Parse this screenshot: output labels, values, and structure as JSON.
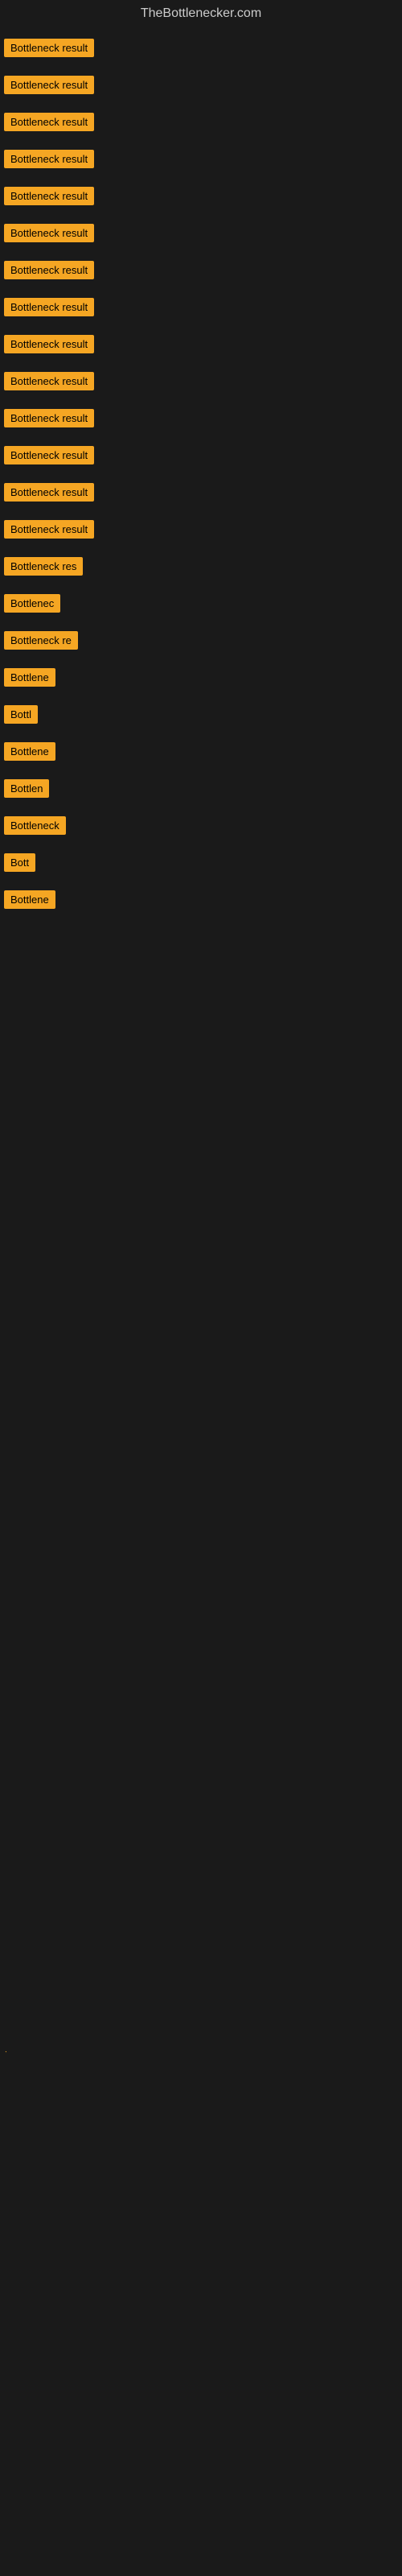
{
  "site": {
    "title": "TheBottlenecker.com"
  },
  "items": [
    {
      "id": 1,
      "label": "Bottleneck result",
      "width": 130
    },
    {
      "id": 2,
      "label": "Bottleneck result",
      "width": 130
    },
    {
      "id": 3,
      "label": "Bottleneck result",
      "width": 130
    },
    {
      "id": 4,
      "label": "Bottleneck result",
      "width": 130
    },
    {
      "id": 5,
      "label": "Bottleneck result",
      "width": 130
    },
    {
      "id": 6,
      "label": "Bottleneck result",
      "width": 130
    },
    {
      "id": 7,
      "label": "Bottleneck result",
      "width": 130
    },
    {
      "id": 8,
      "label": "Bottleneck result",
      "width": 130
    },
    {
      "id": 9,
      "label": "Bottleneck result",
      "width": 130
    },
    {
      "id": 10,
      "label": "Bottleneck result",
      "width": 130
    },
    {
      "id": 11,
      "label": "Bottleneck result",
      "width": 130
    },
    {
      "id": 12,
      "label": "Bottleneck result",
      "width": 130
    },
    {
      "id": 13,
      "label": "Bottleneck result",
      "width": 130
    },
    {
      "id": 14,
      "label": "Bottleneck result",
      "width": 130
    },
    {
      "id": 15,
      "label": "Bottleneck res",
      "width": 110
    },
    {
      "id": 16,
      "label": "Bottlenec",
      "width": 80
    },
    {
      "id": 17,
      "label": "Bottleneck re",
      "width": 100
    },
    {
      "id": 18,
      "label": "Bottlene",
      "width": 72
    },
    {
      "id": 19,
      "label": "Bottl",
      "width": 52
    },
    {
      "id": 20,
      "label": "Bottlene",
      "width": 72
    },
    {
      "id": 21,
      "label": "Bottlen",
      "width": 65
    },
    {
      "id": 22,
      "label": "Bottleneck",
      "width": 85
    },
    {
      "id": 23,
      "label": "Bott",
      "width": 44
    },
    {
      "id": 24,
      "label": "Bottlene",
      "width": 72
    }
  ],
  "bottom_label": "·"
}
